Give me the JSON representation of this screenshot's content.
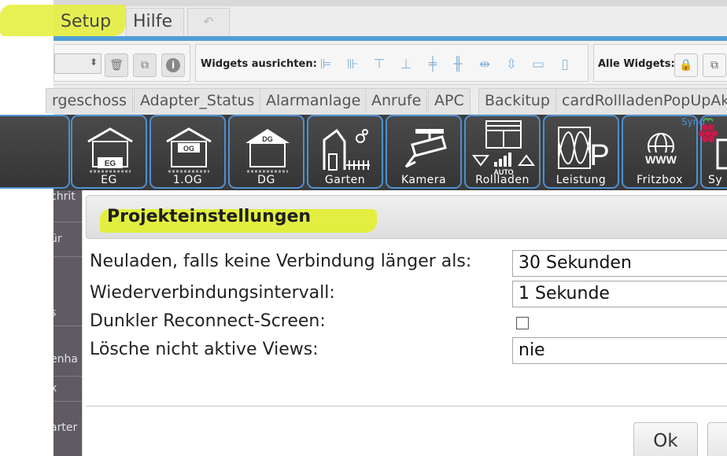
{
  "menu": {
    "setup_label": "Setup",
    "hilfe_label": "Hilfe",
    "undo_icon": "undo-icon"
  },
  "toolbar": {
    "align_label": "Widgets ausrichten:",
    "all_widgets_label": "Alle Widgets:",
    "icons": [
      "delete-icon",
      "copy-icon",
      "info-icon",
      "lock-icon",
      "open-icon"
    ]
  },
  "view_tabs": [
    "rgeschoss",
    "Adapter_Status",
    "Alarmanlage",
    "Anrufe",
    "APC",
    "Backitup",
    "cardRollladenPopUpAk"
  ],
  "icon_bar": {
    "items": [
      "EG",
      "1.OG",
      "DG",
      "Garten",
      "Kamera",
      "Rollladen",
      "Leistung",
      "Fritzbox",
      "Sy"
    ],
    "eg_sign": "EG",
    "og_sign": "OG",
    "dg_sign": "DG",
    "auto_label": "AUTO",
    "p_letter": "P",
    "www_label": "WWW",
    "rpi_text": "Syno"
  },
  "sidebar": {
    "items": [
      "chrit",
      "ür",
      "s",
      "enha",
      "x",
      "arter"
    ]
  },
  "dialog": {
    "title": "Projekteinstellungen",
    "rows": [
      {
        "label": "Neuladen, falls keine Verbindung länger als:",
        "value": "30 Sekunden"
      },
      {
        "label": "Wiederverbindungsintervall:",
        "value": "1 Sekunde"
      },
      {
        "label": "Dunkler Reconnect-Screen:",
        "value": ""
      },
      {
        "label": "Lösche nicht aktive Views:",
        "value": "nie"
      }
    ],
    "ok_label": "Ok"
  },
  "colors": {
    "accent_blue": "#4f9ed8",
    "highlight_yellow": "#e1ef2e",
    "icon_bar_bg": "#3c3c3c",
    "icon_border": "#4f8fd0"
  }
}
